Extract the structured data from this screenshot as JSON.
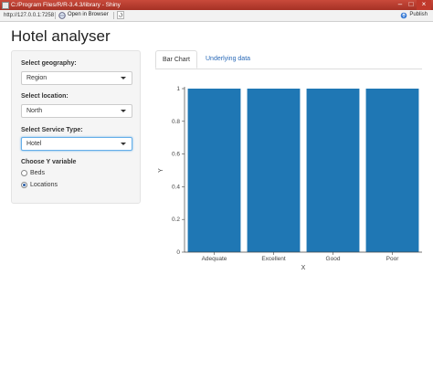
{
  "window": {
    "title": "C:/Program Files/R/R-3.4.3/library - Shiny"
  },
  "toolbar": {
    "url": "http://127.0.0.1:7258",
    "open_label": "Open in Browser",
    "publish_label": "Publish"
  },
  "app": {
    "title": "Hotel analyser"
  },
  "sidebar": {
    "geography": {
      "label": "Select geography:",
      "value": "Region"
    },
    "location": {
      "label": "Select location:",
      "value": "North"
    },
    "service": {
      "label": "Select Service Type:",
      "value": "Hotel"
    },
    "yvar": {
      "label": "Choose Y variable",
      "options": [
        "Beds",
        "Locations"
      ],
      "selected": "Locations"
    }
  },
  "tabs": [
    "Bar Chart",
    "Underlying data"
  ],
  "chart_data": {
    "type": "bar",
    "categories": [
      "Adequate",
      "Excellent",
      "Good",
      "Poor"
    ],
    "values": [
      1,
      1,
      1,
      1
    ],
    "xlabel": "X",
    "ylabel": "Y",
    "ylim": [
      0,
      1
    ],
    "yticks": [
      "0",
      "0.2",
      "0.4",
      "0.6",
      "0.8",
      "1"
    ],
    "bar_color": "#1f77b4"
  }
}
